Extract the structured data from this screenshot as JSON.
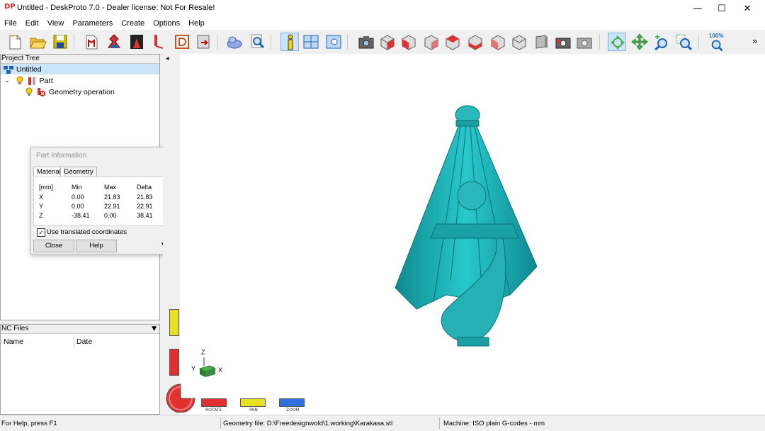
{
  "window": {
    "title": "Untitled - DeskProto 7.0 - Dealer license: Not For Resale!",
    "app_icon": "DP"
  },
  "window_controls": {
    "minimize": "—",
    "maximize": "☐",
    "close": "✕"
  },
  "menu": [
    "File",
    "Edit",
    "View",
    "Parameters",
    "Create",
    "Options",
    "Help"
  ],
  "toolbar": {
    "zoom_label": "100%",
    "overflow": "»"
  },
  "project_tree": {
    "header": "Project Tree",
    "root": "Untitled",
    "part": "Part",
    "operation": "Geometry operation"
  },
  "nc_files": {
    "header": "NC Files",
    "columns": [
      "Name",
      "Date"
    ]
  },
  "part_info": {
    "title": "Part Information",
    "tabs": [
      "Material",
      "Geometry"
    ],
    "headers": [
      "[mm]",
      "Min",
      "Max",
      "Delta"
    ],
    "rows": [
      [
        "X",
        "0.00",
        "21.83",
        "21.83"
      ],
      [
        "Y",
        "0.00",
        "22.91",
        "22.91"
      ],
      [
        "Z",
        "-38.41",
        "0.00",
        "38.41"
      ]
    ],
    "checkbox_label": "Use translated coordinates",
    "checkbox_checked": true,
    "close_label": "Close",
    "help_label": "Help"
  },
  "viewport": {
    "axes": {
      "x": "X",
      "y": "Y",
      "z": "Z"
    },
    "mouse_legend": [
      {
        "label": "ROTATE",
        "color": "#e03030"
      },
      {
        "label": "PAN",
        "color": "#e8e020"
      },
      {
        "label": "ZOOM",
        "color": "#3070e0"
      }
    ],
    "model_color": "#20b2b8"
  },
  "status": {
    "help": "For Help, press F1",
    "geometry_file": "Geometry file: D:\\Freedesignwold\\1.working\\Karakasa.stl",
    "machine": "Machine: ISO plain G-codes - mm"
  }
}
